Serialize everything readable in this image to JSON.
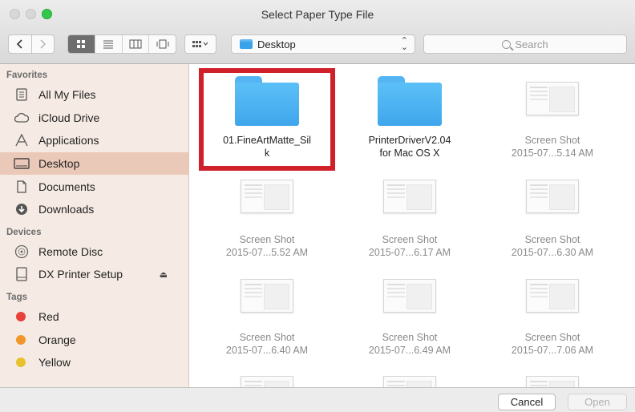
{
  "window": {
    "title": "Select Paper Type File"
  },
  "toolbar": {
    "location": "Desktop",
    "search_placeholder": "Search"
  },
  "sidebar": {
    "favorites_title": "Favorites",
    "favorites": [
      {
        "label": "All My Files",
        "icon": "all-files-icon"
      },
      {
        "label": "iCloud Drive",
        "icon": "cloud-icon"
      },
      {
        "label": "Applications",
        "icon": "applications-icon"
      },
      {
        "label": "Desktop",
        "icon": "desktop-icon",
        "selected": true
      },
      {
        "label": "Documents",
        "icon": "documents-icon"
      },
      {
        "label": "Downloads",
        "icon": "downloads-icon"
      }
    ],
    "devices_title": "Devices",
    "devices": [
      {
        "label": "Remote Disc",
        "icon": "disc-icon"
      },
      {
        "label": "DX Printer Setup",
        "icon": "drive-icon",
        "eject": "⏏"
      }
    ],
    "tags_title": "Tags",
    "tags": [
      {
        "label": "Red",
        "color": "#e8413a"
      },
      {
        "label": "Orange",
        "color": "#f0962a"
      },
      {
        "label": "Yellow",
        "color": "#e8c22e"
      }
    ]
  },
  "files": [
    {
      "line1": "01.FineArtMatte_Sil",
      "line2": "k",
      "kind": "folder"
    },
    {
      "line1": "PrinterDriverV2.04",
      "line2": "for Mac OS X",
      "kind": "folder"
    },
    {
      "line1": "Screen Shot",
      "line2": "2015-07...5.14 AM",
      "kind": "screenshot"
    },
    {
      "line1": "Screen Shot",
      "line2": "2015-07...5.52 AM",
      "kind": "screenshot"
    },
    {
      "line1": "Screen Shot",
      "line2": "2015-07...6.17 AM",
      "kind": "screenshot"
    },
    {
      "line1": "Screen Shot",
      "line2": "2015-07...6.30 AM",
      "kind": "screenshot"
    },
    {
      "line1": "Screen Shot",
      "line2": "2015-07...6.40 AM",
      "kind": "screenshot"
    },
    {
      "line1": "Screen Shot",
      "line2": "2015-07...6.49 AM",
      "kind": "screenshot"
    },
    {
      "line1": "Screen Shot",
      "line2": "2015-07...7.06 AM",
      "kind": "screenshot"
    }
  ],
  "buttons": {
    "cancel": "Cancel",
    "open": "Open"
  },
  "colors": {
    "highlight": "#d0202a",
    "sidebar_bg": "#f6ebe4",
    "selected_bg": "#ebc9b8",
    "folder": "#5cc0f7"
  }
}
